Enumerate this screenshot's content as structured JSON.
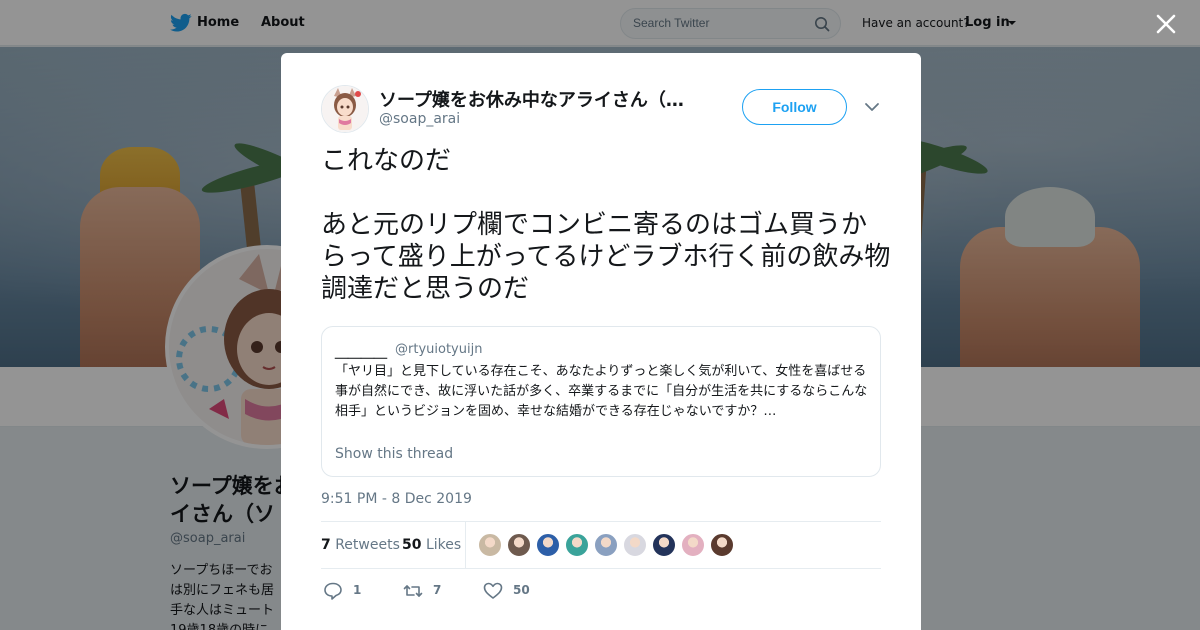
{
  "header": {
    "nav_home": "Home",
    "nav_about": "About",
    "search_placeholder": "Search Twitter",
    "have_account": "Have an account?",
    "login": "Log in"
  },
  "profile": {
    "name_line1": "ソープ嬢をお",
    "name_line2": "イさん（ソ",
    "handle": "@soap_arai",
    "bio_lines": [
      "ソープちほーでお",
      "は別にフェネも居",
      "手な人はミュート",
      "19歳18歳の時に"
    ]
  },
  "tweet": {
    "display_name": "ソープ嬢をお休み中なアライさん（…",
    "username": "@soap_arai",
    "follow_label": "Follow",
    "text_para1": "これなのだ",
    "text_para2": "あと元のリプ欄でコンビニ寄るのはゴム買うからって盛り上がってるけどラブホ行く前の飲み物調達だと思うのだ",
    "quote": {
      "name": "＿＿＿＿",
      "handle": "@rtyuiotyuijn",
      "text": "「ヤリ目」と見下している存在こそ、あなたよりずっと楽しく気が利いて、女性を喜ばせる事が自然にでき、故に浮いた話が多く、卒業するまでに「自分が生活を共にするならこんな相手」というビジョンを固め、幸せな結婚ができる存在じゃないですか？…",
      "link": "Show this thread"
    },
    "timestamp": "9:51 PM - 8 Dec 2019",
    "retweets_count": "7",
    "retweets_label": "Retweets",
    "likes_count": "50",
    "likes_label": "Likes",
    "likers": [
      {
        "name": "liker-1",
        "color": "#c9b9a3"
      },
      {
        "name": "liker-2",
        "color": "#6e5a4e"
      },
      {
        "name": "liker-3",
        "color": "#2d5fa8"
      },
      {
        "name": "liker-4",
        "color": "#3aa39a"
      },
      {
        "name": "liker-5",
        "color": "#8aa0c0"
      },
      {
        "name": "liker-6",
        "color": "#d8d8e0"
      },
      {
        "name": "liker-7",
        "color": "#23335a"
      },
      {
        "name": "liker-8",
        "color": "#e3b0c0"
      },
      {
        "name": "liker-9",
        "color": "#5a3a2e"
      }
    ],
    "actions": {
      "reply_count": "1",
      "retweet_count": "7",
      "like_count": "50"
    }
  },
  "colors": {
    "accent": "#1da1f2",
    "text_primary": "#14171a",
    "text_secondary": "#657786"
  }
}
